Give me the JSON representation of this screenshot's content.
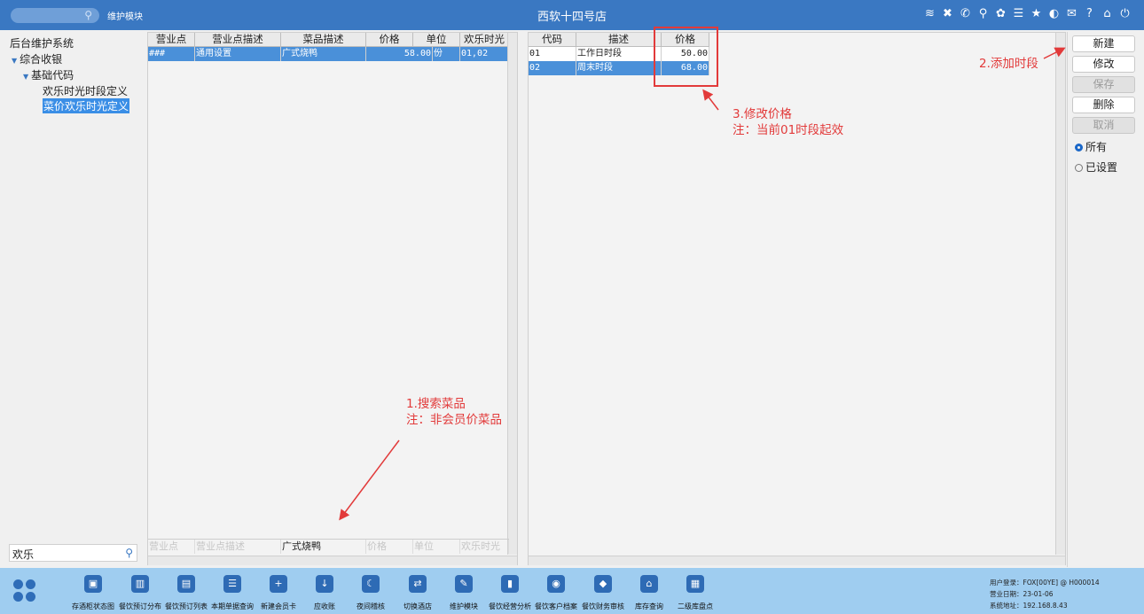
{
  "topbar": {
    "module_label": "维护模块",
    "store_title": "西软十四号店",
    "icons": [
      "wifi-icon",
      "tools-icon",
      "phone-icon",
      "search-user-icon",
      "palette-icon",
      "menu-icon",
      "star-icon",
      "moon-icon",
      "mail-icon",
      "help-icon",
      "home-icon",
      "power-icon"
    ],
    "icon_glyphs": [
      "≋",
      "✖",
      "✆",
      "⚲",
      "✿",
      "☰",
      "★",
      "◐",
      "✉",
      "?",
      "⌂",
      "⏻"
    ]
  },
  "tree": {
    "root": "后台维护系统",
    "level1": "综合收银",
    "level2": "基础代码",
    "item1": "欢乐时光时段定义",
    "item2": "菜价欢乐时光定义"
  },
  "left_search": {
    "value": "欢乐"
  },
  "dish_grid": {
    "columns": [
      "营业点",
      "营业点描述",
      "菜品描述",
      "价格",
      "单位",
      "欢乐时光"
    ],
    "rows": [
      {
        "point": "###",
        "point_desc": "通用设置",
        "dish_desc": "广式烧鸭",
        "price": "58.00",
        "unit": "份",
        "happy_hour": "01,02"
      }
    ],
    "filter": [
      "营业点",
      "营业点描述",
      "广式烧鸭",
      "价格",
      "单位",
      "欢乐时光"
    ]
  },
  "period_grid": {
    "columns": [
      "代码",
      "描述",
      "价格"
    ],
    "rows": [
      {
        "code": "01",
        "desc": "工作日时段",
        "price": "50.00"
      },
      {
        "code": "02",
        "desc": "周末时段",
        "price": "68.00"
      }
    ]
  },
  "right_panel": {
    "new": "新建",
    "edit": "修改",
    "save": "保存",
    "delete": "删除",
    "cancel": "取消",
    "radio_all": "所有",
    "radio_set": "已设置"
  },
  "annotations": {
    "a1_line1": "1.搜索菜品",
    "a1_line2": "注：非会员价菜品",
    "a2": "2.添加时段",
    "a3_line1": "3.修改价格",
    "a3_line2": "注：当前01时段起效"
  },
  "bottombar": {
    "items": [
      {
        "label": "存酒柜状态图",
        "glyph": "▣"
      },
      {
        "label": "餐饮预订分布",
        "glyph": "▥"
      },
      {
        "label": "餐饮预订列表",
        "glyph": "▤"
      },
      {
        "label": "本期单据查询",
        "glyph": "☰"
      },
      {
        "label": "新建会员卡",
        "glyph": "+"
      },
      {
        "label": "应收账",
        "glyph": "↓"
      },
      {
        "label": "夜间稽核",
        "glyph": "☾"
      },
      {
        "label": "切换酒店",
        "glyph": "⇄"
      },
      {
        "label": "维护模块",
        "glyph": "✎"
      },
      {
        "label": "餐饮经营分析",
        "glyph": "▮"
      },
      {
        "label": "餐饮客户档案",
        "glyph": "◉"
      },
      {
        "label": "餐饮财务审核",
        "glyph": "◆"
      },
      {
        "label": "库存查询",
        "glyph": "⌂"
      },
      {
        "label": "二级库盘点",
        "glyph": "▦"
      }
    ],
    "user_line": "用户登录：FOX[00YE] @ H000014",
    "date_line": "营业日期：23-01-06",
    "addr_line": "系统地址：192.168.8.43"
  },
  "colors": {
    "topbar": "#3a78c2",
    "bottombar": "#9fcdf0",
    "selection": "#4a90d9",
    "annotation": "#e23a3a"
  }
}
